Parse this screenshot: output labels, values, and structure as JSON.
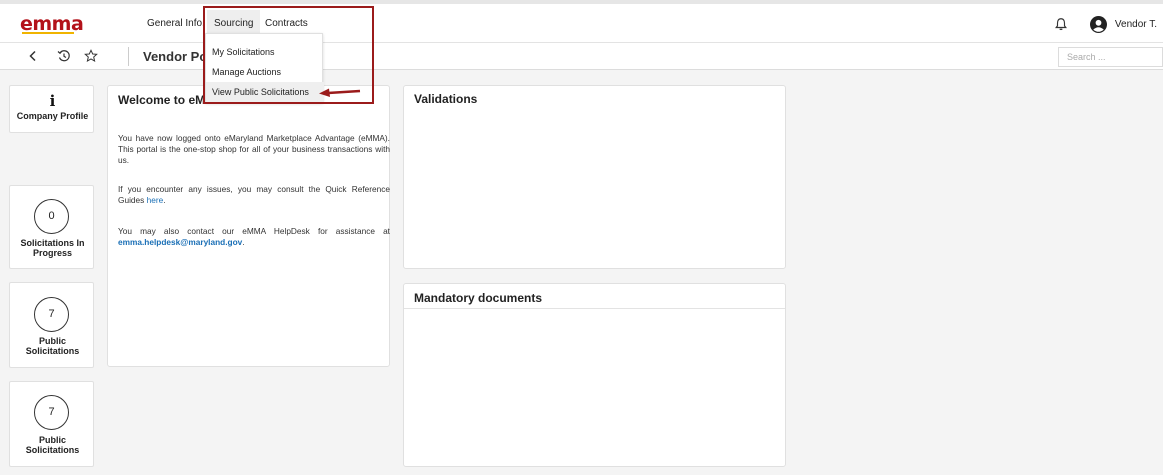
{
  "header": {
    "logo_text": "emma",
    "nav": [
      "General Info.",
      "Sourcing",
      "Contracts"
    ],
    "user_label": "Vendor T."
  },
  "toolbar": {
    "page_title": "Vendor Po",
    "search_placeholder": "Search ..."
  },
  "dropdown": {
    "items": [
      "My Solicitations",
      "Manage Auctions",
      "View Public Solicitations"
    ]
  },
  "tiles": [
    {
      "icon": "i",
      "label": "Company Profile"
    },
    {
      "count": "0",
      "label_lines": [
        "Solicitations In",
        "Progress"
      ]
    },
    {
      "count": "7",
      "label_lines": [
        "Public",
        "Solicitations"
      ]
    },
    {
      "count": "7",
      "label_lines": [
        "Public",
        "Solicitations"
      ]
    }
  ],
  "welcome": {
    "title": "Welcome to eMMA",
    "p1": "You have now logged onto eMaryland Marketplace Advantage (eMMA). This portal is the one-stop shop for all of your business transactions with us.",
    "p2_text": "If you encounter any issues, you may consult the Quick Reference Guides ",
    "p2_link": "here",
    "p2_end": ".",
    "p3_text": "You may also contact our eMMA HelpDesk for assistance at ",
    "p3_link": "emma.helpdesk@maryland.gov",
    "p3_end": "."
  },
  "validations": {
    "title": "Validations"
  },
  "mandatory": {
    "title": "Mandatory documents"
  },
  "colors": {
    "brand": "#b3121a",
    "annotation": "#9b1b1b",
    "link": "#1a6fb6"
  }
}
